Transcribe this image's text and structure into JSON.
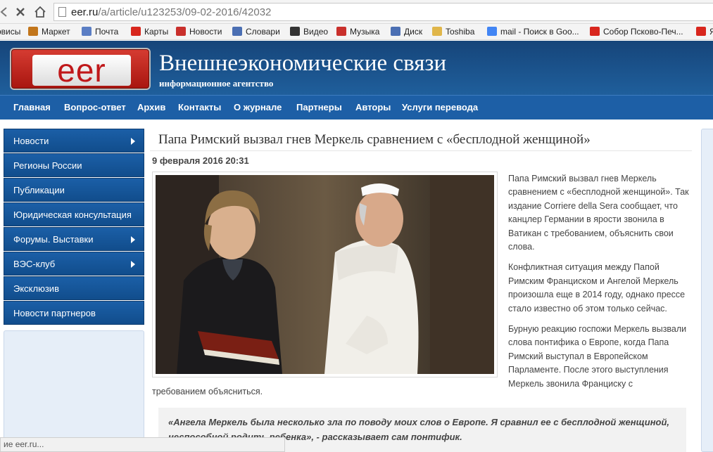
{
  "browser": {
    "url_main": "eer.ru",
    "url_path": "/a/article/u123253/09-02-2016/42032",
    "bookmarks": [
      {
        "label": "рвисы",
        "icon": "services-icon",
        "color": "#888888"
      },
      {
        "label": "Маркет",
        "icon": "market-icon",
        "color": "#c2761b"
      },
      {
        "label": "Почта",
        "icon": "mail-icon",
        "color": "#5b7ec4"
      },
      {
        "label": "Карты",
        "icon": "maps-pin-icon",
        "color": "#d8261d"
      },
      {
        "label": "Новости",
        "icon": "news-icon",
        "color": "#c9302c"
      },
      {
        "label": "Словари",
        "icon": "dictionary-icon",
        "color": "#4b6fb3"
      },
      {
        "label": "Видео",
        "icon": "video-icon",
        "color": "#333333"
      },
      {
        "label": "Музыка",
        "icon": "music-icon",
        "color": "#c9302c"
      },
      {
        "label": "Диск",
        "icon": "disk-icon",
        "color": "#4b6fb3"
      },
      {
        "label": "Toshiba",
        "icon": "folder-icon",
        "color": "#e0b64a"
      },
      {
        "label": "mail - Поиск в Goo...",
        "icon": "google-icon",
        "color": "#4285f4"
      },
      {
        "label": "Собор Псково-Печ...",
        "icon": "yandex-icon",
        "color": "#d8261d"
      },
      {
        "label": "Я",
        "icon": "yandex-icon",
        "color": "#d8261d"
      }
    ],
    "status": "ие eer.ru..."
  },
  "site": {
    "logo_text": "eer",
    "title": "Внешнеэкономические связи",
    "subtitle": "информационное агентство",
    "nav": [
      "Главная",
      "Вопрос-ответ",
      "Архив",
      "Контакты",
      "О журнале",
      "Партнеры",
      "Авторы",
      "Услуги перевода"
    ]
  },
  "sidebar": {
    "items": [
      {
        "label": "Новости",
        "has_arrow": true
      },
      {
        "label": "Регионы России",
        "has_arrow": false
      },
      {
        "label": "Публикации",
        "has_arrow": false
      },
      {
        "label": "Юридическая консультация",
        "has_arrow": false
      },
      {
        "label": "Форумы. Выставки",
        "has_arrow": true
      },
      {
        "label": "ВЭС-клуб",
        "has_arrow": true
      },
      {
        "label": "Эксклюзив",
        "has_arrow": false
      },
      {
        "label": "Новости партнеров",
        "has_arrow": false
      }
    ]
  },
  "article": {
    "title": "Папа Римский вызвал гнев Меркель сравнением с «бесплодной женщиной»",
    "date": "9 февраля 2016 20:31",
    "paragraphs": [
      "Папа Римский вызвал гнев Меркель сравнением с «бесплодной женщиной». Так издание Corriere della Sera сообщает, что канцлер Германии в ярости звонила в Ватикан с требованием, объяснить свои слова.",
      "Конфликтная ситуация между Папой Римским Франциском и Ангелой Меркель произошла еще в 2014 году, однако прессе стало известно об этом только сейчас.",
      "Бурную реакцию госпожи Меркель вызвали слова понтифика о Европе, когда Папа Римский выступал в Европейском Парламенте. После этого выступления Меркель звонила Франциску с"
    ],
    "continuation": "требованием объясниться.",
    "quote": "«Ангела Меркель была несколько зла по поводу моих слов о Европе. Я сравнил ее с бесплодной женщиной, неспособной родить ребенка», - рассказывает сам понтифик."
  }
}
